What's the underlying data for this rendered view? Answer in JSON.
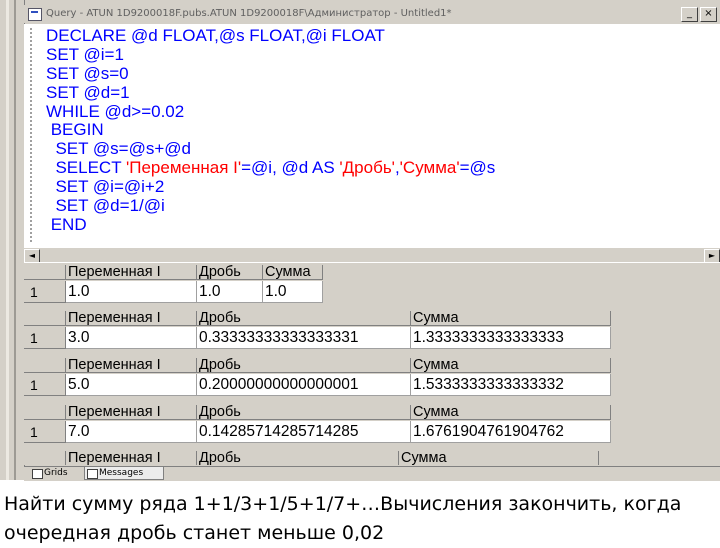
{
  "window": {
    "title": "Query - ATUN 1D9200018F.pubs.ATUN 1D9200018F\\Администратор - Untitled1*",
    "close_glyph": "×"
  },
  "editor": {
    "lines": [
      [
        {
          "t": "DECLARE @d FLOAT,@s FLOAT,@i FLOAT",
          "c": "kw"
        }
      ],
      [
        {
          "t": "SET @i=1",
          "c": "kw"
        }
      ],
      [
        {
          "t": "SET @s=0",
          "c": "kw"
        }
      ],
      [
        {
          "t": "SET @d=1",
          "c": "kw"
        }
      ],
      [
        {
          "t": "WHILE @d>=0.02",
          "c": "kw"
        }
      ],
      [
        {
          "t": " BEGIN",
          "c": "kw"
        }
      ],
      [
        {
          "t": "  SET @s=@s+@d",
          "c": "kw"
        }
      ],
      [
        {
          "t": "  SELECT ",
          "c": "kw"
        },
        {
          "t": "'Переменная I'",
          "c": "str"
        },
        {
          "t": "=@i, @d AS ",
          "c": "kw"
        },
        {
          "t": "'Дробь'",
          "c": "str"
        },
        {
          "t": ",",
          "c": "kw"
        },
        {
          "t": "'Сумма'",
          "c": "str"
        },
        {
          "t": "=@s",
          "c": "kw"
        }
      ],
      [
        {
          "t": "  SET @i=@i+2",
          "c": "kw"
        }
      ],
      [
        {
          "t": "  SET @d=1/@i",
          "c": "kw"
        }
      ],
      [
        {
          "t": " END",
          "c": "kw"
        }
      ]
    ]
  },
  "scroll": {
    "left_glyph": "◄",
    "right_glyph": "►"
  },
  "results": [
    {
      "headers": [
        "Переменная I",
        "Дробь",
        "Сумма"
      ],
      "row_num": "1",
      "cells": [
        "1.0",
        "1.0",
        "1.0"
      ]
    },
    {
      "headers": [
        "Переменная I",
        "Дробь",
        "Сумма"
      ],
      "row_num": "1",
      "cells": [
        "3.0",
        "0.33333333333333331",
        "1.3333333333333333"
      ]
    },
    {
      "headers": [
        "Переменная I",
        "Дробь",
        "Сумма"
      ],
      "row_num": "1",
      "cells": [
        "5.0",
        "0.20000000000000001",
        "1.5333333333333332"
      ]
    },
    {
      "headers": [
        "Переменная I",
        "Дробь",
        "Сумма"
      ],
      "row_num": "1",
      "cells": [
        "7.0",
        "0.14285714285714285",
        "1.6761904761904762"
      ]
    },
    {
      "headers": [
        "Переменная I",
        "Дробь",
        "Сумма"
      ]
    }
  ],
  "tabs": [
    "Grids",
    "Messages"
  ],
  "caption": "Найти сумму ряда 1+1/3+1/5+1/7+…Вычисления закончить, когда очередная дробь станет меньше 0,02"
}
